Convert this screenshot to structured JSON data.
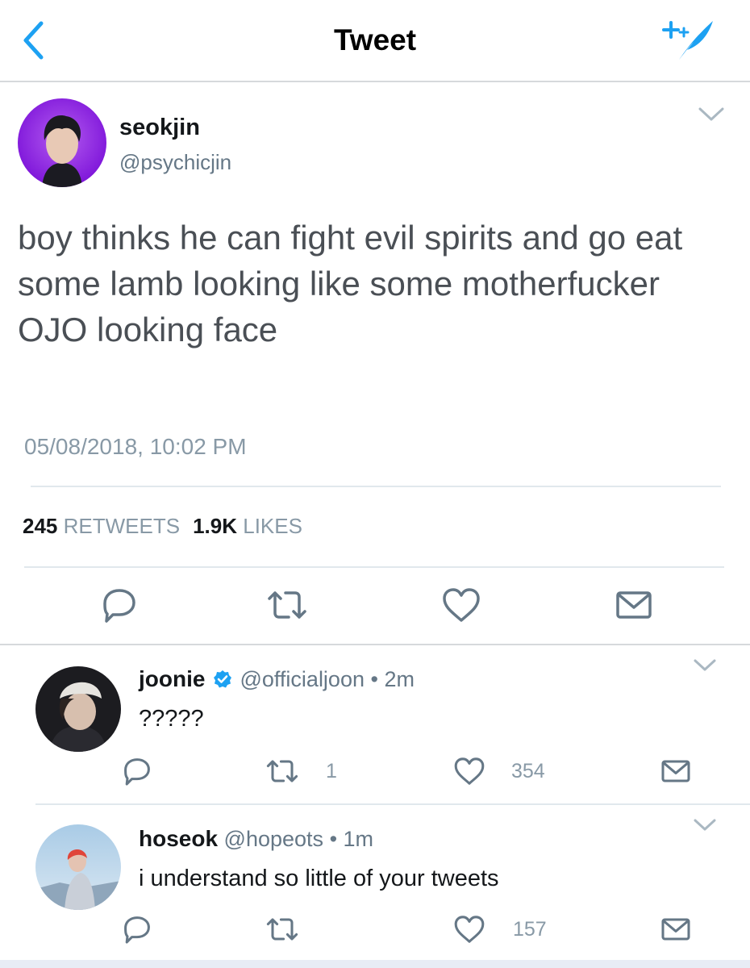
{
  "header": {
    "title": "Tweet",
    "back_icon": "chevron-left-icon",
    "compose_icon": "sparkle-feather-icon",
    "accent": "#1da1f2"
  },
  "tweet": {
    "name": "seokjin",
    "handle": "@psychicjin",
    "text": "boy thinks he can fight evil spirits and go eat some lamb looking like some motherfucker OJO looking face",
    "timestamp": "05/08/2018, 10:02 PM",
    "retweets_count": "245",
    "retweets_label": "RETWEETS",
    "likes_count": "1.9K",
    "likes_label": "LIKES",
    "actions": [
      "reply-icon",
      "retweet-icon",
      "heart-icon",
      "mail-icon"
    ]
  },
  "replies": [
    {
      "name": "joonie",
      "verified": true,
      "handle": "@officialjoon",
      "time": "2m",
      "text": "?????",
      "retweets": "1",
      "likes": "354"
    },
    {
      "name": "hoseok",
      "verified": false,
      "handle": "@hopeots",
      "time": "1m",
      "text": "i understand so little of your tweets",
      "retweets": "",
      "likes": "157"
    }
  ],
  "colors": {
    "text_primary": "#14171a",
    "text_secondary": "#657786",
    "text_muted": "#8899a6",
    "icon": "#657786",
    "accent": "#1da1f2",
    "verified": "#1da1f2",
    "divider": "#e1e8ed"
  }
}
